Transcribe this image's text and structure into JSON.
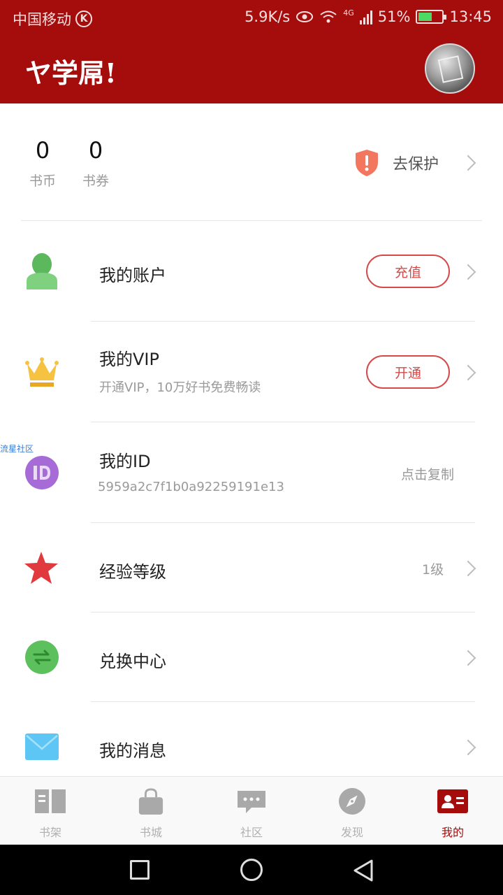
{
  "status_bar": {
    "carrier": "中国移动",
    "k_badge": "K",
    "speed": "5.9K/s",
    "network": "4G",
    "battery": "51%",
    "battery_level": 0.51,
    "time": "13:45"
  },
  "header": {
    "title": "ヤ学屌!"
  },
  "stats": {
    "coins_value": "0",
    "coins_label": "书币",
    "coupons_value": "0",
    "coupons_label": "书券",
    "protect_label": "去保护"
  },
  "menu": {
    "account": {
      "title": "我的账户",
      "button": "充值"
    },
    "vip": {
      "title": "我的VIP",
      "subtitle": "开通VIP，10万好书免费畅读",
      "button": "开通"
    },
    "id": {
      "title": "我的ID",
      "value": "5959a2c7f1b0a92259191e13",
      "action": "点击复制"
    },
    "level": {
      "title": "经验等级",
      "value": "1级"
    },
    "exchange": {
      "title": "兑换中心"
    },
    "messages": {
      "title": "我的消息"
    }
  },
  "watermark": "流星社区",
  "tabs": [
    {
      "label": "书架",
      "icon": "book-icon",
      "active": false
    },
    {
      "label": "书城",
      "icon": "shopping-bag-icon",
      "active": false
    },
    {
      "label": "社区",
      "icon": "chat-icon",
      "active": false
    },
    {
      "label": "发现",
      "icon": "compass-icon",
      "active": false
    },
    {
      "label": "我的",
      "icon": "profile-card-icon",
      "active": true
    }
  ],
  "colors": {
    "brand_red": "#a50c0c",
    "accent_red": "#d44a4a",
    "account_green": "#5cb85c",
    "crown_yellow": "#f5c242",
    "id_purple": "#a66bd6",
    "star_red": "#e0393e",
    "exchange_green": "#5cc05c",
    "mail_blue": "#5ec6f5"
  }
}
